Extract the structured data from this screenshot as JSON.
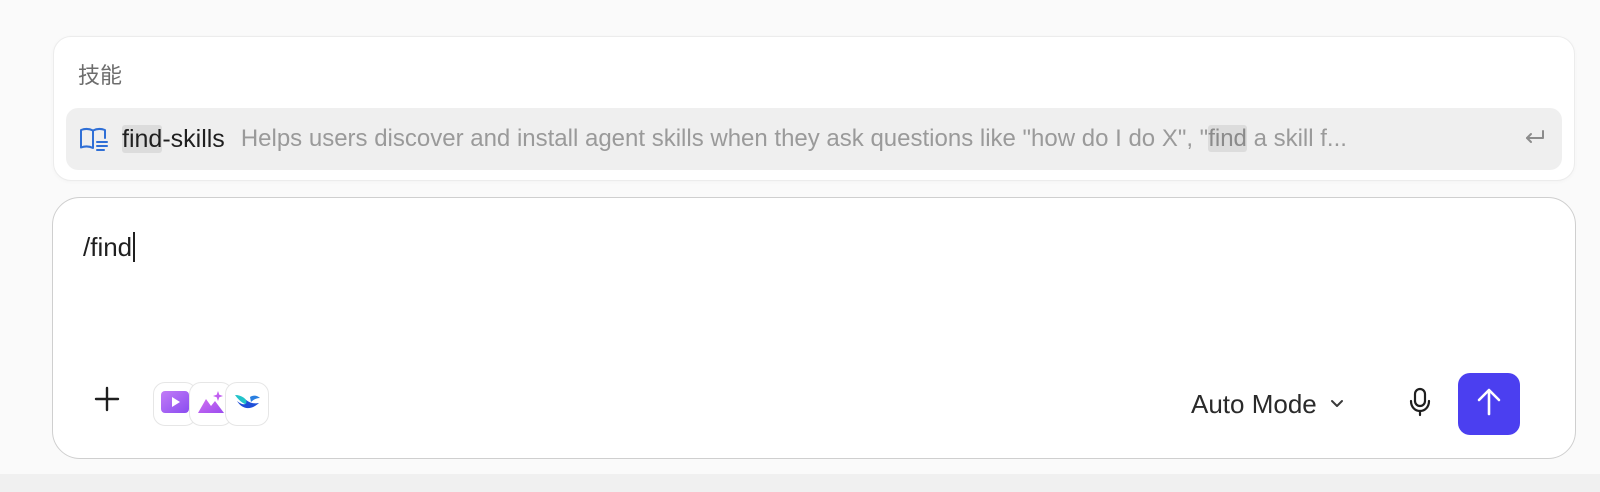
{
  "popup": {
    "heading": "技能",
    "suggestion": {
      "icon": "book-icon",
      "name_match": "find",
      "name_rest": "-skills",
      "desc_before": "Helps users discover and install agent skills when they ask questions like \"how do I do X\", \"",
      "desc_match": "find",
      "desc_after": " a skill f...",
      "action_icon": "enter-icon"
    }
  },
  "composer": {
    "input_value": "/find",
    "tools": [
      {
        "name": "video-tool-icon",
        "color": "#9b5cf0"
      },
      {
        "name": "image-generate-tool-icon",
        "color": "#b45bea"
      },
      {
        "name": "bird-logo-icon",
        "color": "#1e4fd8"
      }
    ],
    "mode_label": "Auto Mode",
    "send_color": "#4b3ff0"
  }
}
